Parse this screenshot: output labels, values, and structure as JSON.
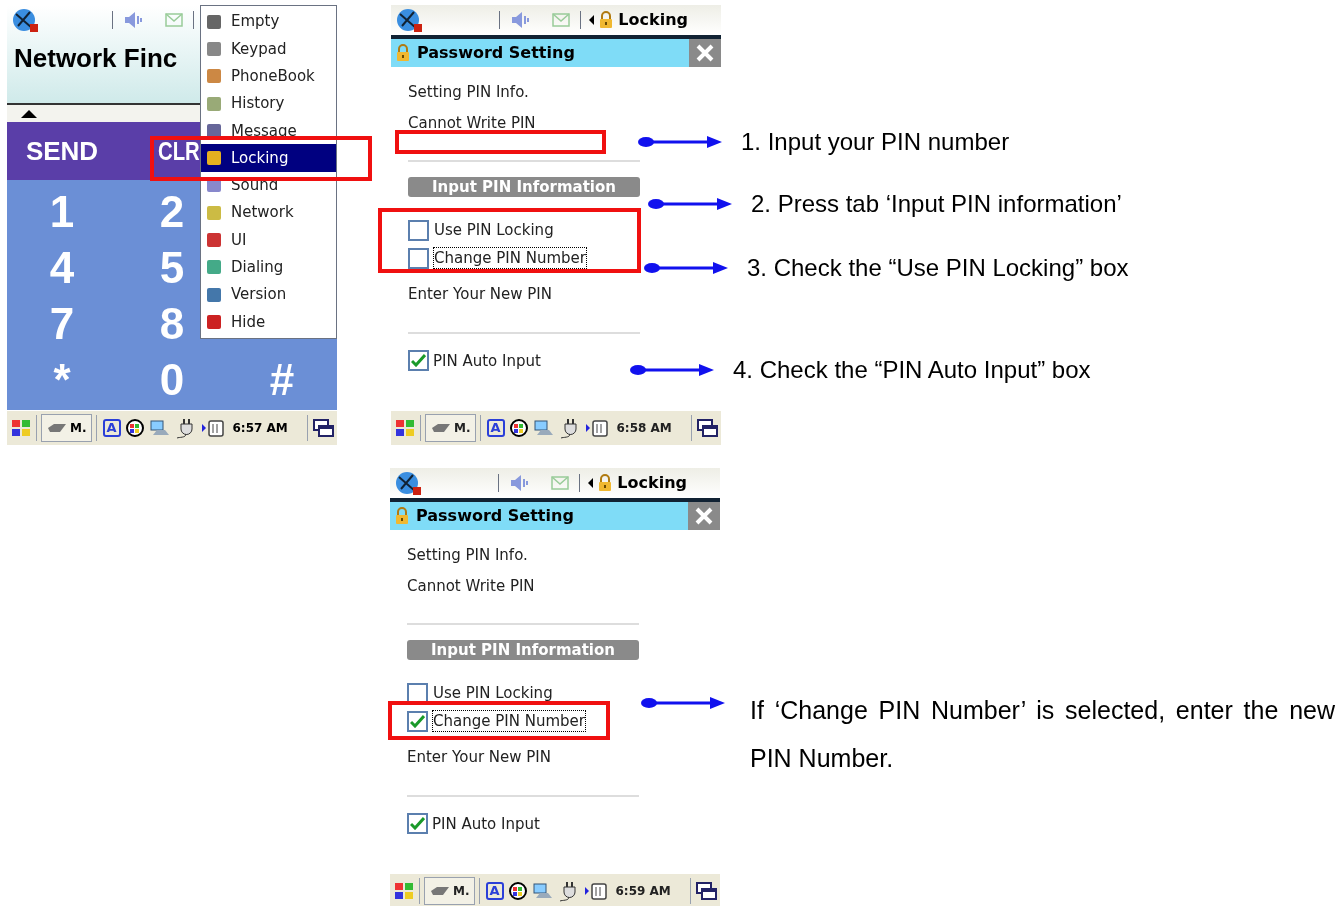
{
  "screens": [
    {
      "kind": "dialer",
      "title": "Network Finc",
      "keypad": {
        "send": "SEND",
        "clear": "CLR",
        "rows": [
          [
            "1",
            "2"
          ],
          [
            "4",
            "5"
          ],
          [
            "7",
            "8"
          ],
          [
            "*",
            "0",
            "#"
          ]
        ]
      },
      "menu": [
        {
          "label": "Empty",
          "selected": false
        },
        {
          "label": "Keypad",
          "selected": false
        },
        {
          "label": "PhoneBook",
          "selected": false
        },
        {
          "label": "History",
          "selected": false
        },
        {
          "label": "Message",
          "selected": false
        },
        {
          "label": "Locking",
          "selected": true
        },
        {
          "label": "Sound",
          "selected": false
        },
        {
          "label": "Network",
          "selected": false
        },
        {
          "label": "UI",
          "selected": false
        },
        {
          "label": "Dialing",
          "selected": false
        },
        {
          "label": "Version",
          "selected": false
        },
        {
          "label": "Hide",
          "selected": false
        }
      ],
      "taskbar": {
        "app": "M.",
        "ime": "A",
        "time": "6:57 AM"
      }
    },
    {
      "kind": "password",
      "status_title": "Locking",
      "title": "Password Setting",
      "info": "Setting PIN Info.",
      "status": "Cannot Write PIN",
      "tab": "Input PIN Information",
      "options": [
        {
          "label": "Use PIN Locking",
          "checked": false,
          "focused": false
        },
        {
          "label": "Change PIN Number",
          "checked": false,
          "focused": true
        }
      ],
      "new_pin_label": "Enter Your New PIN",
      "auto_input": {
        "label": "PIN Auto Input",
        "checked": true
      },
      "taskbar": {
        "app": "M.",
        "ime": "A",
        "time": "6:58 AM"
      }
    },
    {
      "kind": "password",
      "status_title": "Locking",
      "title": "Password Setting",
      "info": "Setting PIN Info.",
      "status": "Cannot Write PIN",
      "tab": "Input PIN Information",
      "options": [
        {
          "label": "Use PIN Locking",
          "checked": false,
          "focused": false
        },
        {
          "label": "Change PIN Number",
          "checked": true,
          "focused": true
        }
      ],
      "new_pin_label": "Enter Your New PIN",
      "auto_input": {
        "label": "PIN Auto Input",
        "checked": true
      },
      "taskbar": {
        "app": "M.",
        "ime": "A",
        "time": "6:59 AM"
      }
    }
  ],
  "steps": [
    {
      "text": "1. Input your PIN number"
    },
    {
      "text": "2. Press tab ‘Input PIN information’"
    },
    {
      "text": "3. Check the “Use PIN Locking” box"
    },
    {
      "text": "4. Check the “PIN Auto Input” box"
    }
  ],
  "note": "If ‘Change PIN Number’ is selected, enter the new PIN Number."
}
